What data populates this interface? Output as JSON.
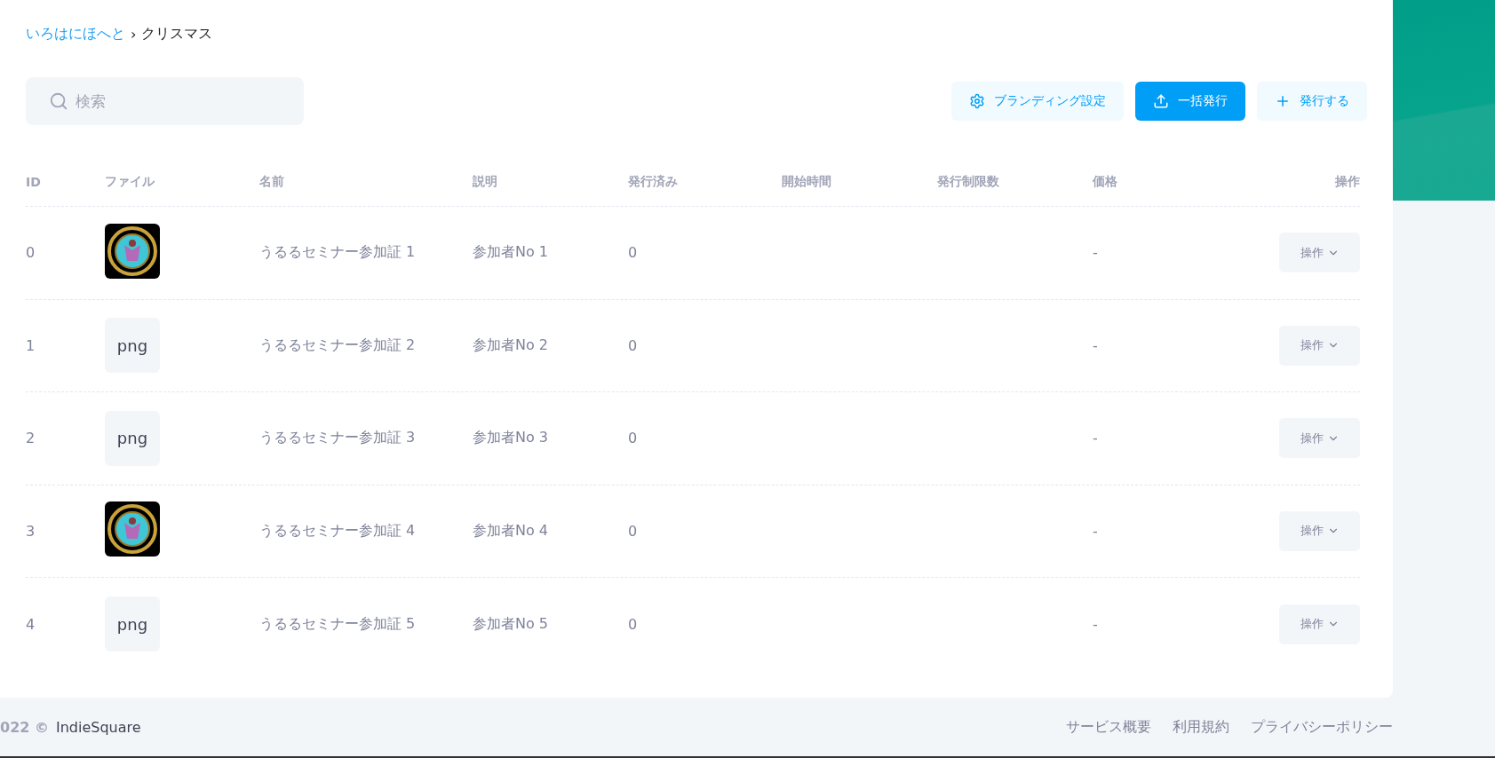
{
  "breadcrumb": {
    "parent": "いろはにほへと",
    "separator": "›",
    "current": "クリスマス"
  },
  "search": {
    "placeholder": "検索"
  },
  "buttons": [
    {
      "kind": "settings",
      "label": "ブランディング設定",
      "primary": false
    },
    {
      "kind": "upload",
      "label": "一括発行",
      "primary": true
    },
    {
      "kind": "add",
      "label": "発行する",
      "primary": false
    }
  ],
  "table": {
    "columns": [
      "ID",
      "ファイル",
      "名前",
      "説明",
      "発行済み",
      "開始時間",
      "発行制限数",
      "価格",
      "操作"
    ],
    "rows": [
      {
        "id": "0",
        "file": {
          "kind": "image"
        },
        "name": "うるるセミナー参加証 1",
        "description": "参加者No 1",
        "issued": "0",
        "price": "-",
        "action": "操作"
      },
      {
        "id": "1",
        "file": {
          "kind": "text",
          "label": "png"
        },
        "name": "うるるセミナー参加証 2",
        "description": "参加者No 2",
        "issued": "0",
        "price": "-",
        "action": "操作"
      },
      {
        "id": "2",
        "file": {
          "kind": "text",
          "label": "png"
        },
        "name": "うるるセミナー参加証 3",
        "description": "参加者No 3",
        "issued": "0",
        "price": "-",
        "action": "操作"
      },
      {
        "id": "3",
        "file": {
          "kind": "image"
        },
        "name": "うるるセミナー参加証 4",
        "description": "参加者No 4",
        "issued": "0",
        "price": "-",
        "action": "操作"
      },
      {
        "id": "4",
        "file": {
          "kind": "text",
          "label": "png"
        },
        "name": "うるるセミナー参加証 5",
        "description": "参加者No 5",
        "issued": "0",
        "price": "-",
        "action": "操作"
      }
    ]
  },
  "footer": {
    "copyright": "022 ©",
    "brand": "IndieSquare",
    "links": [
      "サービス概要",
      "利用規約",
      "プライバシーポリシー"
    ]
  }
}
